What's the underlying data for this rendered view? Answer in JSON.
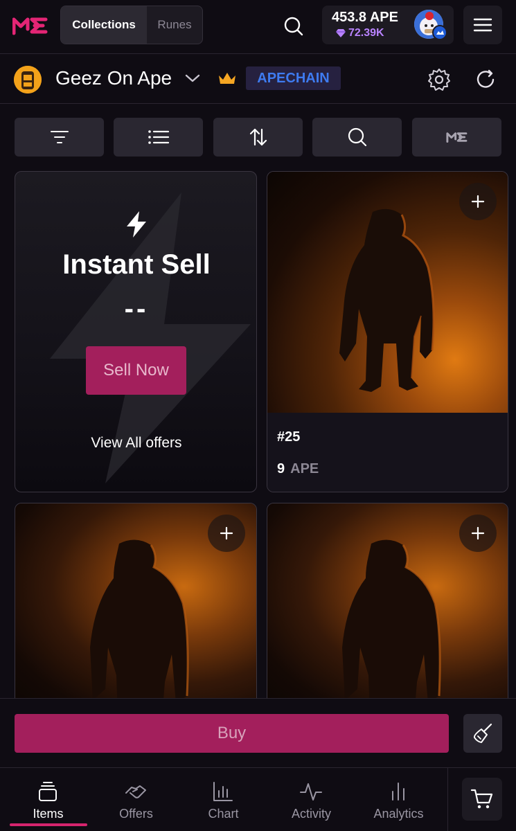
{
  "header": {
    "tabs": [
      {
        "label": "Collections",
        "active": true
      },
      {
        "label": "Runes",
        "active": false
      }
    ],
    "wallet": {
      "balance": "453.8 APE",
      "points": "72.39K"
    },
    "icons": {
      "logo": "magic-eden-logo",
      "search": "search-icon",
      "menu": "hamburger-menu-icon"
    }
  },
  "collection": {
    "name": "Geez On Ape",
    "chain_badge": "APECHAIN",
    "icons": [
      "chevron-down-icon",
      "crown-icon",
      "gear-icon",
      "refresh-icon"
    ]
  },
  "toolbar": {
    "buttons": [
      "filter-icon",
      "list-view-icon",
      "sort-icon",
      "search-icon",
      "magic-eden-icon"
    ]
  },
  "instant_sell": {
    "title": "Instant Sell",
    "price": "--",
    "sell_button": "Sell Now",
    "view_offers": "View All offers"
  },
  "items": [
    {
      "name": "#25",
      "price": "9",
      "currency": "APE"
    },
    {
      "name": "",
      "price": "",
      "currency": ""
    },
    {
      "name": "",
      "price": "",
      "currency": ""
    }
  ],
  "buy_bar": {
    "buy_label": "Buy"
  },
  "bottom_nav": {
    "items": [
      {
        "label": "Items",
        "icon": "items-stack-icon",
        "active": true
      },
      {
        "label": "Offers",
        "icon": "handshake-icon",
        "active": false
      },
      {
        "label": "Chart",
        "icon": "bar-chart-icon",
        "active": false
      },
      {
        "label": "Activity",
        "icon": "activity-pulse-icon",
        "active": false
      },
      {
        "label": "Analytics",
        "icon": "analytics-bars-icon",
        "active": false
      }
    ],
    "cart_icon": "cart-icon"
  },
  "colors": {
    "accent": "#a31f5c",
    "active_underline": "#d6246e",
    "chain_text": "#3e7bf0",
    "points": "#b983ff",
    "background": "#0f0c13"
  }
}
